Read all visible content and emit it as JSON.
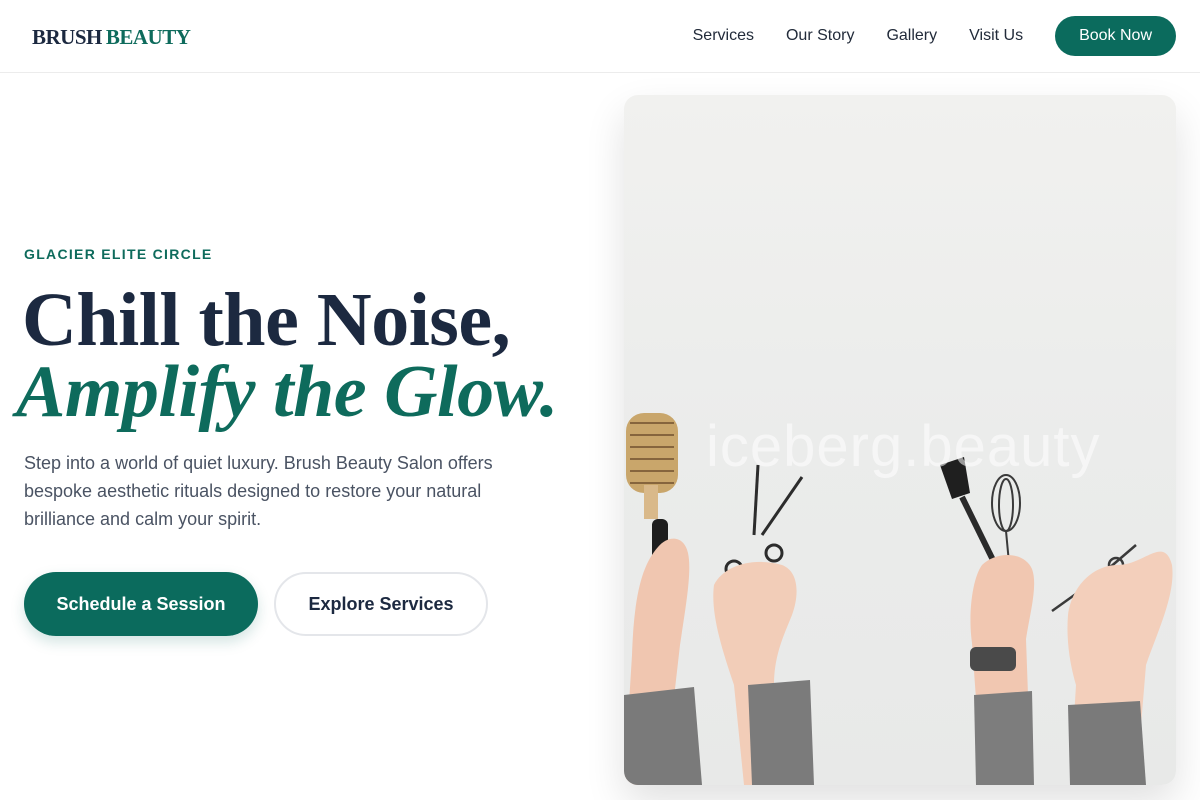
{
  "header": {
    "logo_part1": "BRUSH",
    "logo_part2": "BEAUTY",
    "nav": [
      "Services",
      "Our Story",
      "Gallery",
      "Visit Us"
    ],
    "book_label": "Book Now"
  },
  "hero": {
    "eyebrow": "GLACIER ELITE CIRCLE",
    "headline_line1": "Chill the Noise,",
    "headline_line2": "Amplify the Glow.",
    "lead": "Step into a world of quiet luxury. Brush Beauty Salon offers bespoke aesthetic rituals designed to restore your natural brilliance and calm your spirit.",
    "cta_primary": "Schedule a Session",
    "cta_secondary": "Explore Services",
    "image_watermark": "iceberg.beauty"
  },
  "colors": {
    "accent": "#0b6b5d",
    "navy": "#1c2940"
  }
}
